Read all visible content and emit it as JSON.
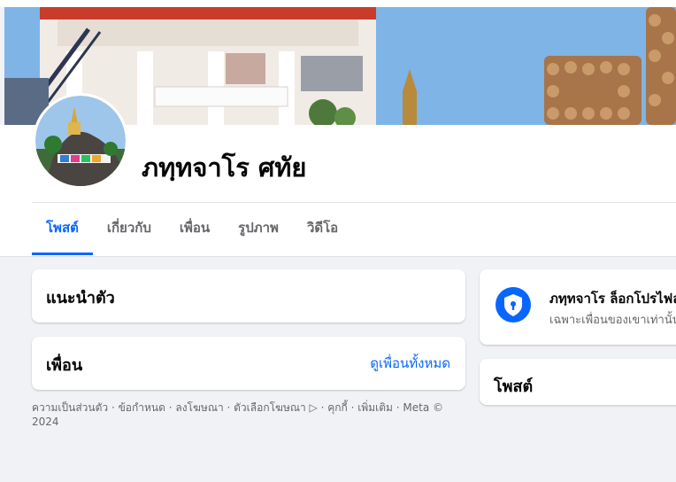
{
  "profile": {
    "name": "ภทฺทจาโร ศทัย"
  },
  "tabs": [
    {
      "label": "โพสต์",
      "active": true
    },
    {
      "label": "เกี่ยวกับ",
      "active": false
    },
    {
      "label": "เพื่อน",
      "active": false
    },
    {
      "label": "รูปภาพ",
      "active": false
    },
    {
      "label": "วิดีโอ",
      "active": false
    }
  ],
  "intro_card": {
    "title": "แนะนำตัว"
  },
  "friends_card": {
    "title": "เพื่อน",
    "see_all": "ดูเพื่อนทั้งหมด"
  },
  "footer": {
    "text": "ความเป็นส่วนตัว · ข้อกำหนด · ลงโฆษณา · ตัวเลือกโฆษณา ▷ · คุกกี้ · เพิ่มเติม · Meta © 2024"
  },
  "locked_card": {
    "title": "ภทฺทจาโร ล็อกโปรไฟล์",
    "subtitle": "เฉพาะเพื่อนของเขาเท่านั้น"
  },
  "posts_card": {
    "title": "โพสต์"
  },
  "colors": {
    "accent": "#0866ff",
    "background": "#f0f2f5",
    "secondary_text": "#65676b"
  }
}
